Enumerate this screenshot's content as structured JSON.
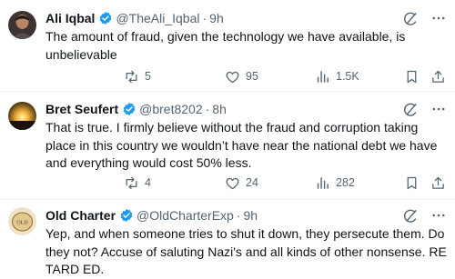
{
  "tweets": [
    {
      "name": "Ali Iqbal",
      "handle": "@TheAli_Iqbal",
      "separator": "·",
      "time": "9h",
      "text": "The amount of fraud, given the technology we have available, is unbelievable",
      "reposts": "5",
      "likes": "95",
      "views": "1.5K"
    },
    {
      "name": "Bret Seufert",
      "handle": "@bret8202",
      "separator": "·",
      "time": "8h",
      "text": "That is true. I firmly believe without the fraud and corruption taking place in this country we wouldn’t have near the national debt we have and everything would cost 50% less.",
      "reposts": "4",
      "likes": "24",
      "views": "282"
    },
    {
      "name": "Old Charter",
      "handle": "@OldCharterExp",
      "separator": "·",
      "time": "9h",
      "text": "Yep, and when someone tries to shut it down, they persecute them. Do they not? Accuse of saluting Nazi's and all kinds of other nonsense. RE TARD ED."
    }
  ],
  "colors": {
    "verified": "#1d9bf0",
    "text": "#0f1419",
    "secondary": "#536471",
    "divider": "#eff3f4"
  },
  "icons": {
    "grok": "grok-icon",
    "more": "more-icon",
    "reply": "reply-icon",
    "repost": "repost-icon",
    "like": "heart-icon",
    "views": "views-icon",
    "bookmark": "bookmark-icon",
    "share": "share-icon"
  }
}
